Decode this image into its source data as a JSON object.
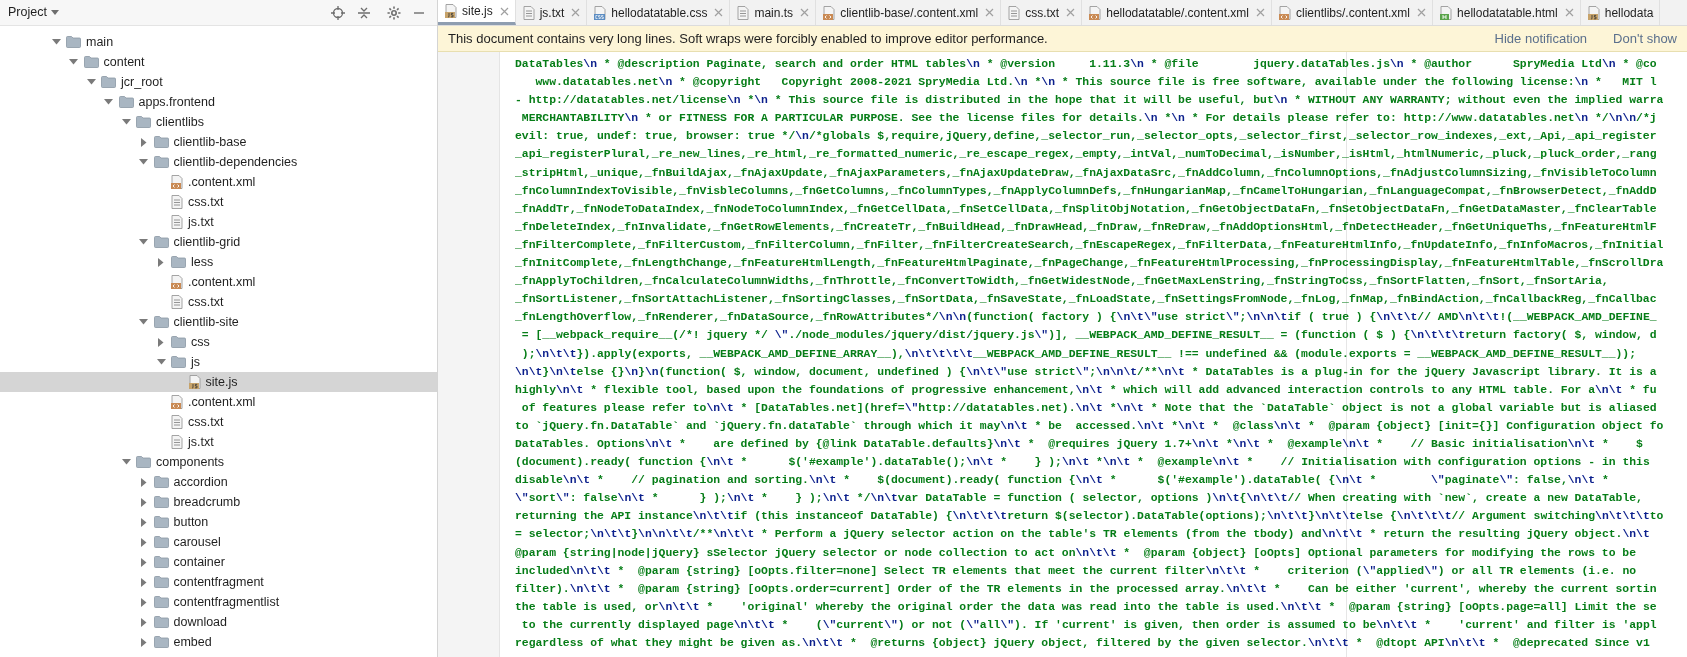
{
  "project_panel": {
    "title": "Project"
  },
  "tree": [
    {
      "name": "main",
      "kind": "folder",
      "expanded": true,
      "selected": false,
      "children": [
        {
          "name": "content",
          "kind": "folder",
          "expanded": true,
          "selected": false,
          "children": [
            {
              "name": "jcr_root",
              "kind": "folder",
              "expanded": true,
              "selected": false,
              "children": [
                {
                  "name": "apps.frontend",
                  "kind": "folder",
                  "expanded": true,
                  "selected": false,
                  "children": [
                    {
                      "name": "clientlibs",
                      "kind": "folder",
                      "expanded": true,
                      "selected": false,
                      "children": [
                        {
                          "name": "clientlib-base",
                          "kind": "folder",
                          "expanded": false,
                          "selected": false
                        },
                        {
                          "name": "clientlib-dependencies",
                          "kind": "folder",
                          "expanded": true,
                          "selected": false,
                          "children": [
                            {
                              "name": ".content.xml",
                              "kind": "xml",
                              "selected": false
                            },
                            {
                              "name": "css.txt",
                              "kind": "text",
                              "selected": false
                            },
                            {
                              "name": "js.txt",
                              "kind": "text",
                              "selected": false
                            }
                          ]
                        },
                        {
                          "name": "clientlib-grid",
                          "kind": "folder",
                          "expanded": true,
                          "selected": false,
                          "children": [
                            {
                              "name": "less",
                              "kind": "folder",
                              "expanded": false,
                              "selected": false
                            },
                            {
                              "name": ".content.xml",
                              "kind": "xml",
                              "selected": false
                            },
                            {
                              "name": "css.txt",
                              "kind": "text",
                              "selected": false
                            }
                          ]
                        },
                        {
                          "name": "clientlib-site",
                          "kind": "folder",
                          "expanded": true,
                          "selected": false,
                          "children": [
                            {
                              "name": "css",
                              "kind": "folder",
                              "expanded": false,
                              "selected": false
                            },
                            {
                              "name": "js",
                              "kind": "folder",
                              "expanded": true,
                              "selected": false,
                              "children": [
                                {
                                  "name": "site.js",
                                  "kind": "js",
                                  "selected": true
                                }
                              ]
                            },
                            {
                              "name": ".content.xml",
                              "kind": "xml",
                              "selected": false
                            },
                            {
                              "name": "css.txt",
                              "kind": "text",
                              "selected": false
                            },
                            {
                              "name": "js.txt",
                              "kind": "text",
                              "selected": false
                            }
                          ]
                        }
                      ]
                    },
                    {
                      "name": "components",
                      "kind": "folder",
                      "expanded": true,
                      "selected": false,
                      "children": [
                        {
                          "name": "accordion",
                          "kind": "folder",
                          "expanded": false,
                          "selected": false
                        },
                        {
                          "name": "breadcrumb",
                          "kind": "folder",
                          "expanded": false,
                          "selected": false
                        },
                        {
                          "name": "button",
                          "kind": "folder",
                          "expanded": false,
                          "selected": false
                        },
                        {
                          "name": "carousel",
                          "kind": "folder",
                          "expanded": false,
                          "selected": false
                        },
                        {
                          "name": "container",
                          "kind": "folder",
                          "expanded": false,
                          "selected": false
                        },
                        {
                          "name": "contentfragment",
                          "kind": "folder",
                          "expanded": false,
                          "selected": false
                        },
                        {
                          "name": "contentfragmentlist",
                          "kind": "folder",
                          "expanded": false,
                          "selected": false
                        },
                        {
                          "name": "download",
                          "kind": "folder",
                          "expanded": false,
                          "selected": false
                        },
                        {
                          "name": "embed",
                          "kind": "folder",
                          "expanded": false,
                          "selected": false
                        }
                      ]
                    }
                  ]
                }
              ]
            }
          ]
        }
      ]
    }
  ],
  "tabs": [
    {
      "label": "site.js",
      "kind": "js",
      "selected": true,
      "closable": true
    },
    {
      "label": "js.txt",
      "kind": "text",
      "selected": false,
      "closable": true
    },
    {
      "label": "hellodatatable.css",
      "kind": "css",
      "selected": false,
      "closable": true
    },
    {
      "label": "main.ts",
      "kind": "text",
      "selected": false,
      "closable": true
    },
    {
      "label": "clientlib-base/.content.xml",
      "kind": "xml",
      "selected": false,
      "closable": true
    },
    {
      "label": "css.txt",
      "kind": "text",
      "selected": false,
      "closable": true
    },
    {
      "label": "hellodatatable/.content.xml",
      "kind": "xml",
      "selected": false,
      "closable": true
    },
    {
      "label": "clientlibs/.content.xml",
      "kind": "xml",
      "selected": false,
      "closable": true
    },
    {
      "label": "hellodatatable.html",
      "kind": "html",
      "selected": false,
      "closable": true
    },
    {
      "label": "hellodata",
      "kind": "js",
      "selected": false,
      "closable": false
    }
  ],
  "notification": {
    "message": "This document contains very long lines. Soft wraps were forcibly enabled to improve editor performance.",
    "actions": [
      "Hide notification",
      "Don't show"
    ]
  },
  "code_lines": [
    "DataTables\\n * @description Paginate, search and order HTML tables\\n * @version     1.11.3\\n * @file        jquery.dataTables.js\\n * @author      SpryMedia Ltd\\n * @co",
    "   www.datatables.net\\n * @copyright   Copyright 2008-2021 SpryMedia Ltd.\\n *\\n * This source file is free software, available under the following license:\\n *   MIT l",
    "- http://datatables.net/license\\n *\\n * This source file is distributed in the hope that it will be useful, but\\n * WITHOUT ANY WARRANTY; without even the implied warra",
    " MERCHANTABILITY\\n * or FITNESS FOR A PARTICULAR PURPOSE. See the license files for details.\\n *\\n * For details please refer to: http://www.datatables.net\\n */\\n\\n/*j",
    "evil: true, undef: true, browser: true */\\n/*globals $,require,jQuery,define,_selector_run,_selector_opts,_selector_first,_selector_row_indexes,_ext,_Api,_api_register",
    "_api_registerPlural,_re_new_lines,_re_html,_re_formatted_numeric,_re_escape_regex,_empty,_intVal,_numToDecimal,_isNumber,_isHtml,_htmlNumeric,_pluck,_pluck_order,_rang",
    "_stripHtml,_unique,_fnBuildAjax,_fnAjaxUpdate,_fnAjaxParameters,_fnAjaxUpdateDraw,_fnAjaxDataSrc,_fnAddColumn,_fnColumnOptions,_fnAdjustColumnSizing,_fnVisibleToColumn",
    "_fnColumnIndexToVisible,_fnVisbleColumns,_fnGetColumns,_fnColumnTypes,_fnApplyColumnDefs,_fnHungarianMap,_fnCamelToHungarian,_fnLanguageCompat,_fnBrowserDetect,_fnAddD",
    "_fnAddTr,_fnNodeToDataIndex,_fnNodeToColumnIndex,_fnGetCellData,_fnSetCellData,_fnSplitObjNotation,_fnGetObjectDataFn,_fnSetObjectDataFn,_fnGetDataMaster,_fnClearTable",
    "_fnDeleteIndex,_fnInvalidate,_fnGetRowElements,_fnCreateTr,_fnBuildHead,_fnDrawHead,_fnDraw,_fnReDraw,_fnAddOptionsHtml,_fnDetectHeader,_fnGetUniqueThs,_fnFeatureHtmlF",
    "_fnFilterComplete,_fnFilterCustom,_fnFilterColumn,_fnFilter,_fnFilterCreateSearch,_fnEscapeRegex,_fnFilterData,_fnFeatureHtmlInfo,_fnUpdateInfo,_fnInfoMacros,_fnInitial",
    "_fnInitComplete,_fnLengthChange,_fnFeatureHtmlLength,_fnFeatureHtmlPaginate,_fnPageChange,_fnFeatureHtmlProcessing,_fnProcessingDisplay,_fnFeatureHtmlTable,_fnScrollDra",
    "_fnApplyToChildren,_fnCalculateColumnWidths,_fnThrottle,_fnConvertToWidth,_fnGetWidestNode,_fnGetMaxLenString,_fnStringToCss,_fnSortFlatten,_fnSort,_fnSortAria,",
    "_fnSortListener,_fnSortAttachListener,_fnSortingClasses,_fnSortData,_fnSaveState,_fnLoadState,_fnSettingsFromNode,_fnLog,_fnMap,_fnBindAction,_fnCallbackReg,_fnCallbac",
    "_fnLengthOverflow,_fnRenderer,_fnDataSource,_fnRowAttributes*/\\n\\n(function( factory ) {\\n\\t\\\"use strict\\\";\\n\\n\\tif ( true ) {\\n\\t\\t// AMD\\n\\t\\t!(__WEBPACK_AMD_DEFINE_",
    " = [__webpack_require__(/*! jquery */ \\\"./node_modules/jquery/dist/jquery.js\\\")], __WEBPACK_AMD_DEFINE_RESULT__ = (function ( $ ) {\\n\\t\\t\\treturn factory( $, window, d",
    " );\\n\\t\\t}).apply(exports, __WEBPACK_AMD_DEFINE_ARRAY__),\\n\\t\\t\\t\\t__WEBPACK_AMD_DEFINE_RESULT__ !== undefined && (module.exports = __WEBPACK_AMD_DEFINE_RESULT__));",
    "\\n\\t}\\n\\telse {}\\n}\\n(function( $, window, document, undefined ) {\\n\\t\\\"use strict\\\";\\n\\n\\t/**\\n\\t * DataTables is a plug-in for the jQuery Javascript library. It is a",
    "highly\\n\\t * flexible tool, based upon the foundations of progressive enhancement,\\n\\t * which will add advanced interaction controls to any HTML table. For a\\n\\t * fu",
    " of features please refer to\\n\\t * [DataTables.net](href=\\\"http://datatables.net).\\n\\t *\\n\\t * Note that the `DataTable` object is not a global variable but is aliased",
    "to `jQuery.fn.DataTable` and `jQuery.fn.dataTable` through which it may\\n\\t * be  accessed.\\n\\t *\\n\\t *  @class\\n\\t *  @param {object} [init={}] Configuration object fo",
    "DataTables. Options\\n\\t *    are defined by {@link DataTable.defaults}\\n\\t *  @requires jQuery 1.7+\\n\\t *\\n\\t *  @example\\n\\t *    // Basic initialisation\\n\\t *    $",
    "(document).ready( function {\\n\\t *      $('#example').dataTable();\\n\\t *    } );\\n\\t *\\n\\t *  @example\\n\\t *    // Initialisation with configuration options - in this",
    "disable\\n\\t *    // pagination and sorting.\\n\\t *    $(document).ready( function {\\n\\t *      $('#example').dataTable( {\\n\\t *        \\\"paginate\\\": false,\\n\\t *",
    "\\\"sort\\\": false\\n\\t *      } );\\n\\t *    } );\\n\\t */\\n\\tvar DataTable = function ( selector, options )\\n\\t{\\n\\t\\t// When creating with `new`, create a new DataTable,",
    "returning the API instance\\n\\t\\tif (this instanceof DataTable) {\\n\\t\\t\\treturn $(selector).DataTable(options);\\n\\t\\t}\\n\\t\\telse {\\n\\t\\t\\t// Argument switching\\n\\t\\t\\tto",
    "= selector;\\n\\t\\t}\\n\\n\\t\\t/**\\n\\t\\t * Perform a jQuery selector action on the table's TR elements (from the tbody) and\\n\\t\\t * return the resulting jQuery object.\\n\\t",
    "@param {string|node|jQuery} sSelector jQuery selector or node collection to act on\\n\\t\\t *  @param {object} [oOpts] Optional parameters for modifying the rows to be",
    "included\\n\\t\\t *  @param {string} [oOpts.filter=none] Select TR elements that meet the current filter\\n\\t\\t *    criterion (\\\"applied\\\") or all TR elements (i.e. no",
    "filter).\\n\\t\\t *  @param {string} [oOpts.order=current] Order of the TR elements in the processed array.\\n\\t\\t *    Can be either 'current', whereby the current sortin",
    "the table is used, or\\n\\t\\t *    'original' whereby the original order the data was read into the table is used.\\n\\t\\t *  @param {string} [oOpts.page=all] Limit the se",
    " to the currently displayed page\\n\\t\\t *    (\\\"current\\\") or not (\\\"all\\\"). If 'current' is given, then order is assumed to be\\n\\t\\t *    'current' and filter is 'appl",
    "regardless of what they might be given as.\\n\\t\\t *  @returns {object} jQuery object, filtered by the given selector.\\n\\t\\t *  @dtopt API\\n\\t\\t *  @deprecated Since v1"
  ]
}
